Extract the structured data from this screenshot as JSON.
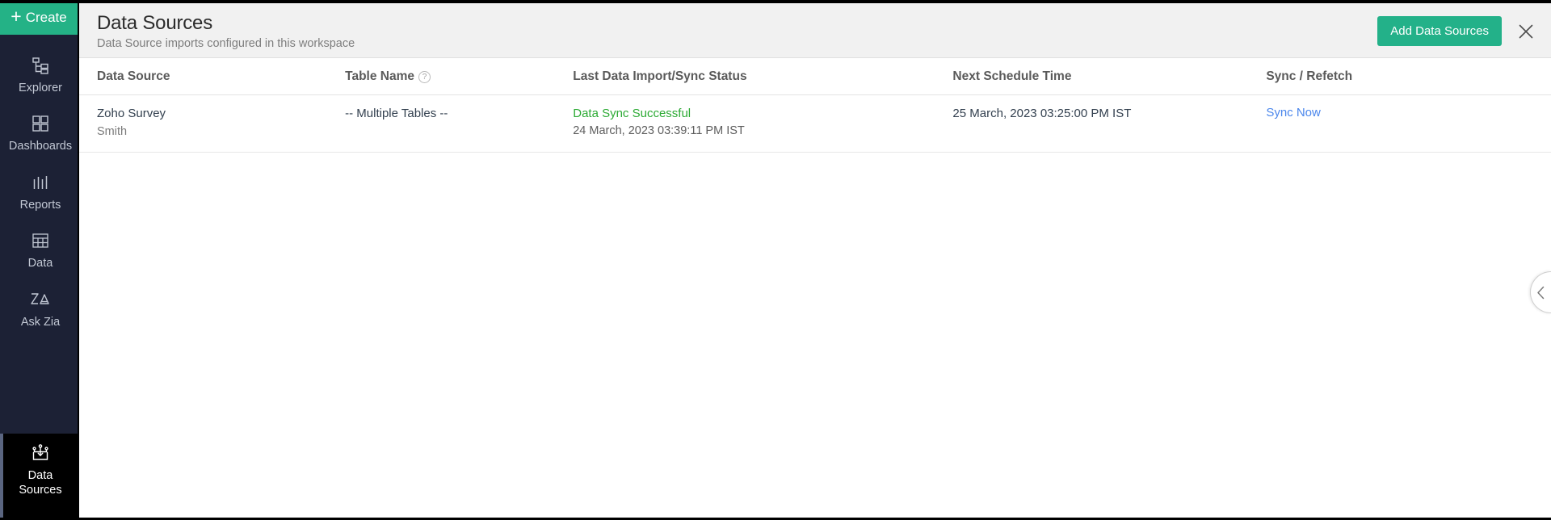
{
  "sidebar": {
    "create_label": "Create",
    "items": [
      {
        "label": "Explorer",
        "icon": "explorer-icon",
        "active": false
      },
      {
        "label": "Dashboards",
        "icon": "dashboards-icon",
        "active": false
      },
      {
        "label": "Reports",
        "icon": "reports-icon",
        "active": false
      },
      {
        "label": "Data",
        "icon": "data-table-icon",
        "active": false
      },
      {
        "label": "Ask Zia",
        "icon": "ask-zia-icon",
        "active": false
      }
    ],
    "bottom_item": {
      "label_line1": "Data",
      "label_line2": "Sources",
      "icon": "data-sources-icon",
      "active": true
    }
  },
  "header": {
    "title": "Data Sources",
    "subtitle": "Data Source imports configured in this workspace",
    "add_button_label": "Add Data Sources",
    "close_icon": "close-icon",
    "accent_color": "#23b189"
  },
  "table": {
    "columns": [
      {
        "label": "Data Source"
      },
      {
        "label": "Table Name",
        "help_icon": "help-icon"
      },
      {
        "label": "Last Data Import/Sync Status"
      },
      {
        "label": "Next Schedule Time"
      },
      {
        "label": "Sync / Refetch"
      }
    ],
    "rows": [
      {
        "source_name": "Zoho Survey",
        "source_sub": "Smith",
        "table_name": "-- Multiple Tables --",
        "status_text": "Data Sync Successful",
        "status_time": "24 March, 2023 03:39:11 PM IST",
        "next_schedule": "25 March, 2023 03:25:00 PM IST",
        "sync_action": "Sync Now",
        "status_color": "#2caa34",
        "link_color": "#4a86ec"
      }
    ]
  },
  "edge_tab": {
    "icon": "chevron-left-icon"
  }
}
